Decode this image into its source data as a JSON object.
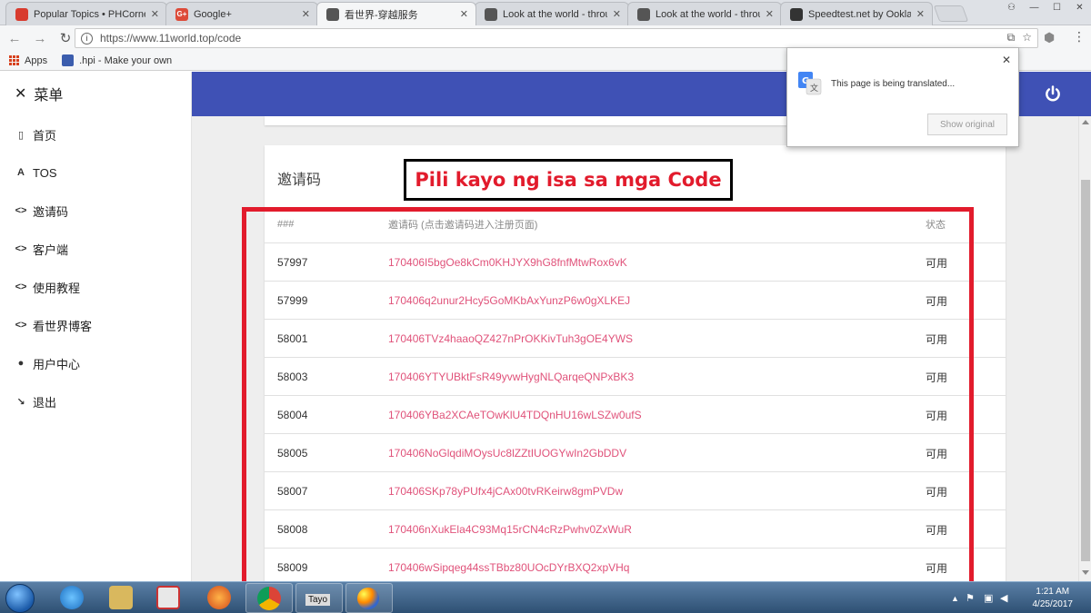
{
  "browser": {
    "tabs": [
      {
        "title": "Popular Topics • PHCorner",
        "fav_color": "#d83b2e",
        "fav_glyph": ""
      },
      {
        "title": "Google+",
        "fav_color": "#dd4b39",
        "fav_glyph": "G+"
      },
      {
        "title": "看世界-穿越服务",
        "fav_color": "#555555",
        "fav_glyph": ""
      },
      {
        "title": "Look at the world - throu",
        "fav_color": "#555555",
        "fav_glyph": ""
      },
      {
        "title": "Look at the world - throu",
        "fav_color": "#555555",
        "fav_glyph": ""
      },
      {
        "title": "Speedtest.net by Ookla -",
        "fav_color": "#333333",
        "fav_glyph": ""
      }
    ],
    "url": "https://www.11world.top/code",
    "bookmarks": [
      {
        "label": "Apps"
      },
      {
        "label": ".hpi - Make your own"
      }
    ]
  },
  "translate_popup": {
    "message": "This page is being translated...",
    "button": "Show original"
  },
  "sidebar": {
    "header": "菜单",
    "items": [
      {
        "icon": "bookmark-icon",
        "glyph": "▯",
        "label": "首页"
      },
      {
        "icon": "tos-icon",
        "glyph": "A",
        "label": "TOS"
      },
      {
        "icon": "code-icon",
        "glyph": "<>",
        "label": "邀请码"
      },
      {
        "icon": "code-icon",
        "glyph": "<>",
        "label": "客户端"
      },
      {
        "icon": "code-icon",
        "glyph": "<>",
        "label": "使用教程"
      },
      {
        "icon": "code-icon",
        "glyph": "<>",
        "label": "看世界博客"
      },
      {
        "icon": "user-icon",
        "glyph": "●",
        "label": "用户中心"
      },
      {
        "icon": "logout-icon",
        "glyph": "↘",
        "label": "退出"
      }
    ]
  },
  "annotation": {
    "label": "Pili kayo ng isa sa mga Code",
    "color": "#e21b2c"
  },
  "card": {
    "title": "邀请码",
    "columns": [
      "###",
      "邀请码 (点击邀请码进入注册页面)",
      "状态"
    ],
    "rows": [
      {
        "id": "57997",
        "code": "170406I5bgOe8kCm0KHJYX9hG8fnfMtwRox6vK",
        "status": "可用"
      },
      {
        "id": "57999",
        "code": "170406q2unur2Hcy5GoMKbAxYunzP6w0gXLKEJ",
        "status": "可用"
      },
      {
        "id": "58001",
        "code": "170406TVz4haaoQZ427nPrOKKivTuh3gOE4YWS",
        "status": "可用"
      },
      {
        "id": "58003",
        "code": "170406YTYUBktFsR49yvwHygNLQarqeQNPxBK3",
        "status": "可用"
      },
      {
        "id": "58004",
        "code": "170406YBa2XCAeTOwKlU4TDQnHU16wLSZw0ufS",
        "status": "可用"
      },
      {
        "id": "58005",
        "code": "170406NoGlqdiMOysUc8lZZtIUOGYwIn2GbDDV",
        "status": "可用"
      },
      {
        "id": "58007",
        "code": "170406SKp78yPUfx4jCAx00tvRKeirw8gmPVDw",
        "status": "可用"
      },
      {
        "id": "58008",
        "code": "170406nXukEla4C93Mq15rCN4cRzPwhv0ZxWuR",
        "status": "可用"
      },
      {
        "id": "58009",
        "code": "170406wSipqeg44ssTBbz80UOcDYrBXQ2xpVHq",
        "status": "可用"
      }
    ]
  },
  "colors": {
    "appbar": "#3f51b5",
    "code_link": "#e0527a"
  },
  "taskbar": {
    "time": "1:21 AM",
    "date": "4/25/2017",
    "button_text": "Tayo"
  }
}
